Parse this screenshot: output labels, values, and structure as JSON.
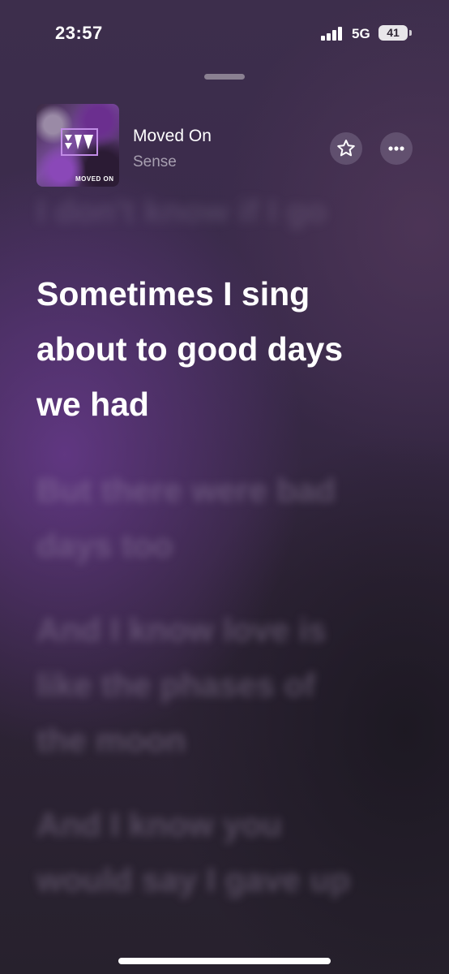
{
  "status_bar": {
    "time": "23:57",
    "network": "5G",
    "battery": "41"
  },
  "track": {
    "title": "Moved On",
    "artist": "Sense",
    "art_text": "MOVED ON"
  },
  "buttons": {
    "favorite_icon": "star-icon",
    "more_icon": "ellipsis-icon"
  },
  "lyrics": {
    "previous": "I don't know if I go",
    "current": [
      "Sometimes I sing",
      "about to good days",
      "we had"
    ],
    "next_1": [
      "But there were bad",
      "days too"
    ],
    "next_2": [
      "And I know love is",
      "like the phases of",
      "the moon"
    ],
    "next_3": [
      "And I know you",
      "would say I gave up"
    ]
  },
  "colors": {
    "accent": "#c18ce6",
    "background": "#3a2a4b"
  }
}
